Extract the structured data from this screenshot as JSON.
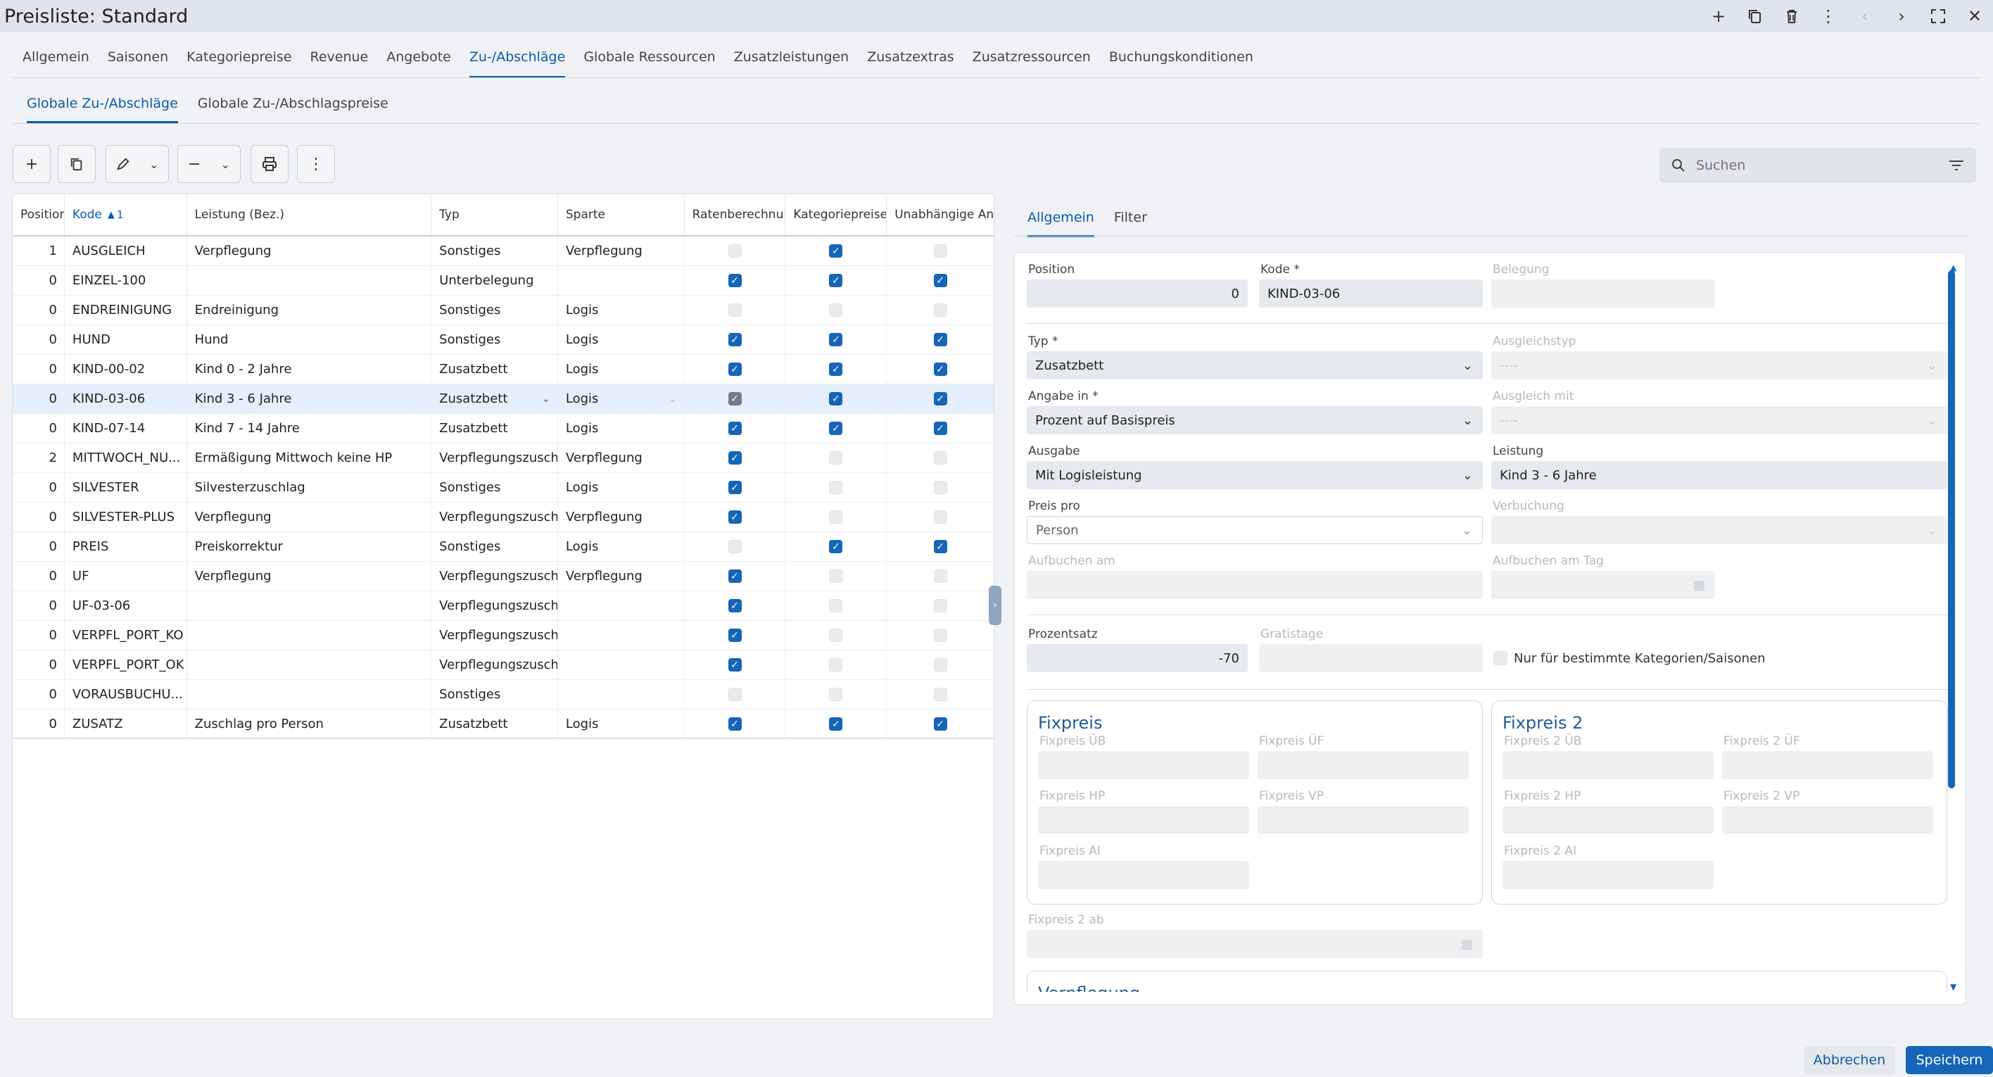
{
  "window": {
    "title": "Preisliste: Standard"
  },
  "tabs": [
    "Allgemein",
    "Saisonen",
    "Kategoriepreise",
    "Revenue",
    "Angebote",
    "Zu-/Abschläge",
    "Globale Ressourcen",
    "Zusatzleistungen",
    "Zusatzextras",
    "Zusatzressourcen",
    "Buchungskonditionen"
  ],
  "active_tab": "Zu-/Abschläge",
  "subtabs": [
    "Globale Zu-/Abschläge",
    "Globale Zu-/Abschlagspreise"
  ],
  "search": {
    "placeholder": "Suchen"
  },
  "grid": {
    "headers": {
      "position": "Position",
      "kode": "Kode",
      "kode_sort": "1",
      "leistung": "Leistung (Bez.)",
      "typ": "Typ",
      "sparte": "Sparte",
      "raten": "Ratenberechnung",
      "kategorie": "Kategoriepreise / ",
      "unabh": "Unabhängige Ang"
    },
    "rows": [
      {
        "pos": "1",
        "kode": "AUSGLEICH",
        "leistung": "Verpflegung",
        "typ": "Sonstiges",
        "sparte": "Verpflegung",
        "c1": 0,
        "c2": 1,
        "c3": 0
      },
      {
        "pos": "0",
        "kode": "EINZEL-100",
        "leistung": "",
        "typ": "Unterbelegung",
        "sparte": "",
        "c1": 1,
        "c2": 1,
        "c3": 1
      },
      {
        "pos": "0",
        "kode": "ENDREINIGUNG",
        "leistung": "Endreinigung",
        "typ": "Sonstiges",
        "sparte": "Logis",
        "c1": 0,
        "c2": 0,
        "c3": 0
      },
      {
        "pos": "0",
        "kode": "HUND",
        "leistung": "Hund",
        "typ": "Sonstiges",
        "sparte": "Logis",
        "c1": 1,
        "c2": 1,
        "c3": 1
      },
      {
        "pos": "0",
        "kode": "KIND-00-02",
        "leistung": "Kind 0 - 2 Jahre",
        "typ": "Zusatzbett",
        "sparte": "Logis",
        "c1": 1,
        "c2": 1,
        "c3": 1
      },
      {
        "pos": "0",
        "kode": "KIND-03-06",
        "leistung": "Kind 3 - 6 Jahre",
        "typ": "Zusatzbett",
        "sparte": "Logis",
        "c1": 2,
        "c2": 1,
        "c3": 1,
        "selected": true
      },
      {
        "pos": "0",
        "kode": "KIND-07-14",
        "leistung": "Kind 7 - 14 Jahre",
        "typ": "Zusatzbett",
        "sparte": "Logis",
        "c1": 1,
        "c2": 1,
        "c3": 1
      },
      {
        "pos": "2",
        "kode": "MITTWOCH_NU...",
        "leistung": "Ermäßigung Mittwoch keine HP",
        "typ": "Verpflegungszuschlag",
        "sparte": "Verpflegung",
        "c1": 1,
        "c2": 0,
        "c3": 0
      },
      {
        "pos": "0",
        "kode": "SILVESTER",
        "leistung": "Silvesterzuschlag",
        "typ": "Sonstiges",
        "sparte": "Logis",
        "c1": 1,
        "c2": 0,
        "c3": 0
      },
      {
        "pos": "0",
        "kode": "SILVESTER-PLUS",
        "leistung": "Verpflegung",
        "typ": "Verpflegungszuschlag",
        "sparte": "Verpflegung",
        "c1": 1,
        "c2": 0,
        "c3": 0
      },
      {
        "pos": "0",
        "kode": "PREIS",
        "leistung": "Preiskorrektur",
        "typ": "Sonstiges",
        "sparte": "Logis",
        "c1": 0,
        "c2": 1,
        "c3": 1
      },
      {
        "pos": "0",
        "kode": "UF",
        "leistung": "Verpflegung",
        "typ": "Verpflegungszuschlag",
        "sparte": "Verpflegung",
        "c1": 1,
        "c2": 0,
        "c3": 0
      },
      {
        "pos": "0",
        "kode": "UF-03-06",
        "leistung": "",
        "typ": "Verpflegungszuschlag",
        "sparte": "",
        "c1": 1,
        "c2": 0,
        "c3": 0
      },
      {
        "pos": "0",
        "kode": "VERPFL_PORT_KO",
        "leistung": "",
        "typ": "Verpflegungszuschlag",
        "sparte": "",
        "c1": 1,
        "c2": 0,
        "c3": 0
      },
      {
        "pos": "0",
        "kode": "VERPFL_PORT_OK",
        "leistung": "",
        "typ": "Verpflegungszuschlag",
        "sparte": "",
        "c1": 1,
        "c2": 0,
        "c3": 0
      },
      {
        "pos": "0",
        "kode": "VORAUSBUCHU...",
        "leistung": "",
        "typ": "Sonstiges",
        "sparte": "",
        "c1": 0,
        "c2": 0,
        "c3": 0
      },
      {
        "pos": "0",
        "kode": "ZUSATZ",
        "leistung": "Zuschlag pro Person",
        "typ": "Zusatzbett",
        "sparte": "Logis",
        "c1": 1,
        "c2": 1,
        "c3": 1
      }
    ]
  },
  "detail": {
    "tabs": [
      "Allgemein",
      "Filter"
    ],
    "position": {
      "label": "Position",
      "value": "0"
    },
    "kode": {
      "label": "Kode *",
      "value": "KIND-03-06"
    },
    "belegung": {
      "label": "Belegung"
    },
    "typ": {
      "label": "Typ *",
      "value": "Zusatzbett"
    },
    "ausgleichstyp": {
      "label": "Ausgleichstyp",
      "value": "----"
    },
    "angabe": {
      "label": "Angabe in *",
      "value": "Prozent auf Basispreis"
    },
    "ausgleich_mit": {
      "label": "Ausgleich mit",
      "value": "----"
    },
    "ausgabe": {
      "label": "Ausgabe",
      "value": "Mit Logisleistung"
    },
    "leistung": {
      "label": "Leistung",
      "value": "Kind 3 - 6 Jahre"
    },
    "preis_pro": {
      "label": "Preis pro",
      "value": "Person"
    },
    "verbuchung": {
      "label": "Verbuchung"
    },
    "aufbuchen_am": {
      "label": "Aufbuchen am"
    },
    "aufbuchen_tag": {
      "label": "Aufbuchen am Tag"
    },
    "prozentsatz": {
      "label": "Prozentsatz",
      "value": "-70"
    },
    "gratistage": {
      "label": "Gratistage"
    },
    "nur_fuer": {
      "label": "Nur für bestimmte Kategorien/Saisonen"
    },
    "fixpreis": {
      "title": "Fixpreis",
      "ub": "Fixpreis ÜB",
      "uf": "Fixpreis ÜF",
      "hp": "Fixpreis HP",
      "vp": "Fixpreis VP",
      "ai": "Fixpreis AI"
    },
    "fixpreis2": {
      "title": "Fixpreis 2",
      "ub": "Fixpreis 2 ÜB",
      "uf": "Fixpreis 2 ÜF",
      "hp": "Fixpreis 2 HP",
      "vp": "Fixpreis 2 VP",
      "ai": "Fixpreis 2 AI"
    },
    "fixpreis2_ab": {
      "label": "Fixpreis 2 ab"
    },
    "verpflegung": {
      "title": "Verpflegung"
    }
  },
  "footer": {
    "cancel": "Abbrechen",
    "save": "Speichern"
  },
  "colors": {
    "accent": "#0b5cad",
    "primary_button": "#1565b8"
  }
}
